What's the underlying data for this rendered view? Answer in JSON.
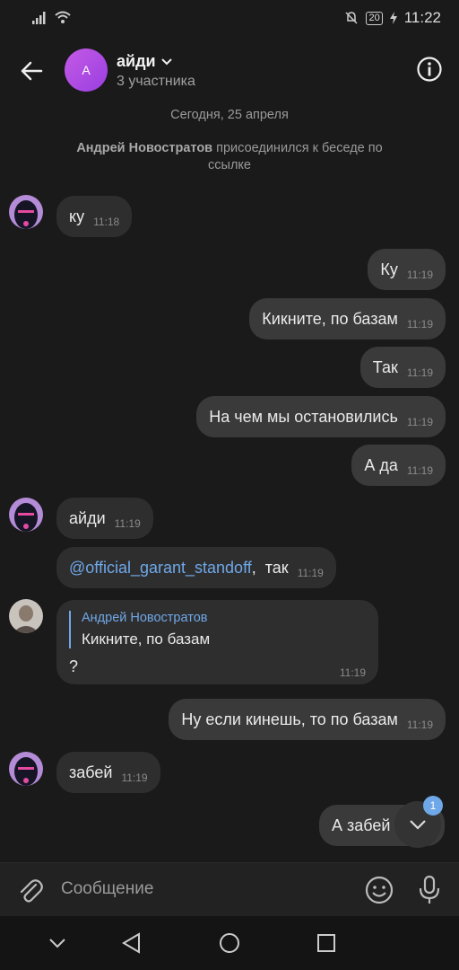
{
  "status": {
    "battery": "20",
    "time": "11:22"
  },
  "header": {
    "avatar_letter": "A",
    "title": "айди",
    "subtitle": "3 участника"
  },
  "date_separator": "Сегодня, 25 апреля",
  "system": {
    "name": "Андрей Новостратов",
    "text": " присоединился к беседе по ссылке"
  },
  "messages": [
    {
      "text": "ку",
      "time": "11:18"
    },
    {
      "text": "Ку",
      "time": "11:19"
    },
    {
      "text": "Кикните, по базам",
      "time": "11:19"
    },
    {
      "text": "Так",
      "time": "11:19"
    },
    {
      "text": "На чем мы остановились",
      "time": "11:19"
    },
    {
      "text": "А да",
      "time": "11:19"
    },
    {
      "text": "айди",
      "time": "11:19"
    },
    {
      "mention": "@official_garant_standoff",
      "text": ",  так",
      "time": "11:19"
    },
    {
      "reply_author": "Андрей Новостратов",
      "reply_text": "Кикните, по базам",
      "text": "?",
      "time": "11:19"
    },
    {
      "text": "Ну если кинешь, то по базам",
      "time": "11:19"
    },
    {
      "text": "забей",
      "time": "11:19"
    },
    {
      "text": "А забей"
    }
  ],
  "scroll_badge": "1",
  "composer": {
    "placeholder": "Сообщение"
  },
  "colors": {
    "accent": "#6fa8e8",
    "avatar": "#b24fe3",
    "bubble_in": "#2e2e2e",
    "bubble_out": "#3a3a3a"
  }
}
